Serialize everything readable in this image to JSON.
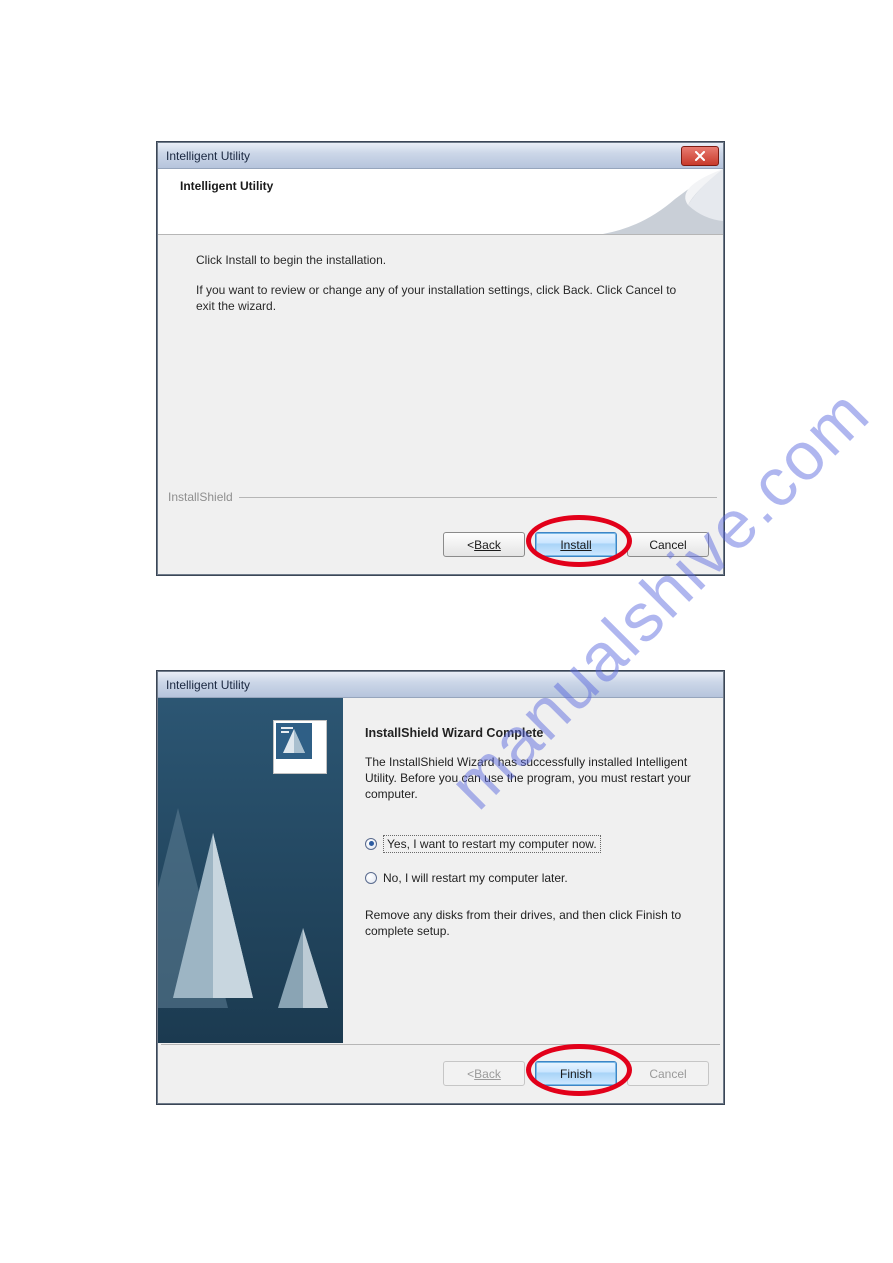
{
  "watermark": "manualshive.com",
  "dialog1": {
    "title": "Intelligent Utility",
    "header": "Intelligent Utility",
    "body": {
      "line1": "Click Install to begin the installation.",
      "line2": "If you want to review or change any of your installation settings, click Back. Click Cancel to exit the wizard."
    },
    "brand": "InstallShield",
    "buttons": {
      "back_prefix": "< ",
      "back": "Back",
      "install": "Install",
      "cancel": "Cancel"
    }
  },
  "dialog2": {
    "title": "Intelligent Utility",
    "heading": "InstallShield Wizard Complete",
    "para1": "The InstallShield Wizard has successfully installed Intelligent Utility.  Before you can use the program, you must restart your computer.",
    "radio_yes": "Yes, I want to restart my computer now.",
    "radio_no": "No, I will restart my computer later.",
    "para2": "Remove any disks from their drives, and then click Finish to complete setup.",
    "buttons": {
      "back_prefix": "< ",
      "back": "Back",
      "finish": "Finish",
      "cancel": "Cancel"
    }
  }
}
